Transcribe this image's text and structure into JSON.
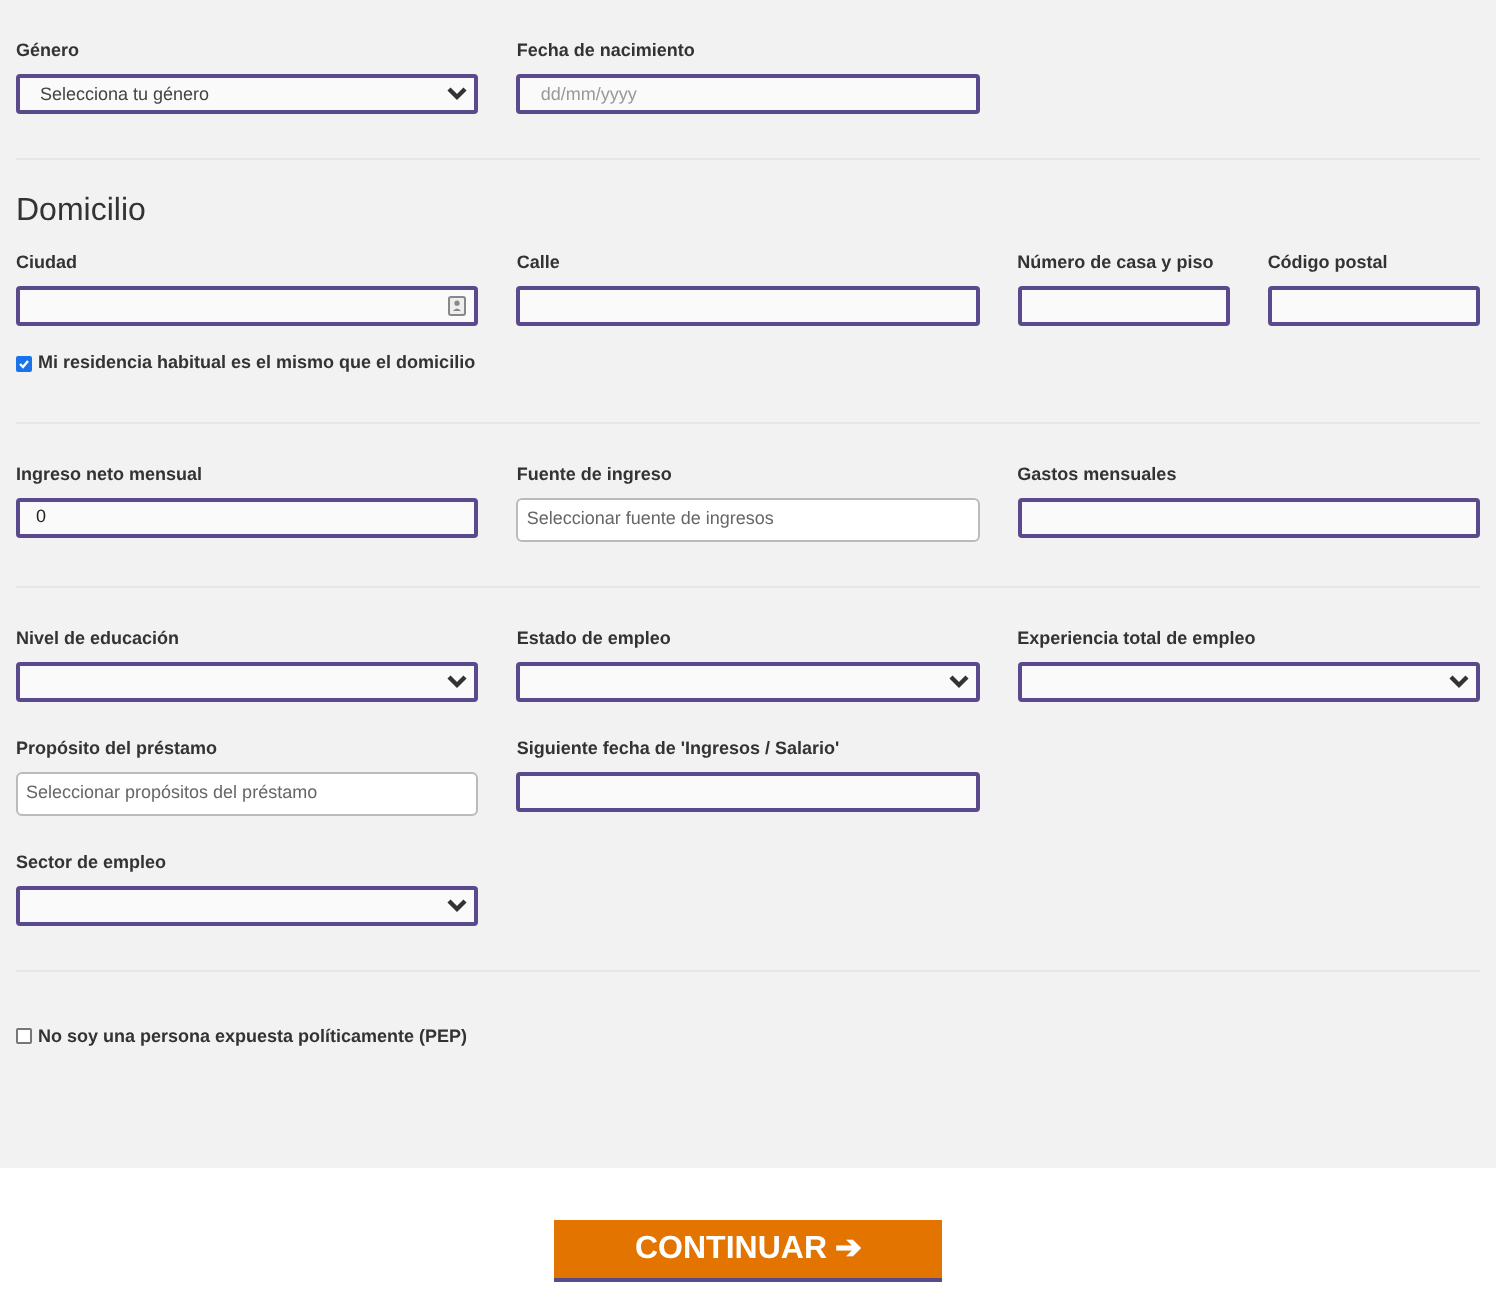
{
  "sections": [
    {
      "rows": [
        [
          {
            "kind": "select",
            "label": "Género",
            "placeholder": "Selecciona tu género"
          },
          {
            "kind": "date",
            "label": "Fecha de nacimiento",
            "placeholder": "dd/mm/yyyy"
          }
        ]
      ]
    },
    {
      "heading": "Domicilio",
      "rows": [
        [
          {
            "kind": "contact",
            "label": "Ciudad"
          },
          {
            "kind": "text",
            "label": "Calle"
          },
          {
            "kind": "pair",
            "fields": [
              {
                "kind": "text",
                "label": "Número de casa y piso"
              },
              {
                "kind": "text",
                "label": "Código postal"
              }
            ]
          }
        ]
      ],
      "checkbox": {
        "label": "Mi residencia habitual es el mismo que el domicilio",
        "checked": true
      }
    },
    {
      "rows": [
        [
          {
            "kind": "text",
            "label": "Ingreso neto mensual",
            "value": "0"
          },
          {
            "kind": "multiselect",
            "label": "Fuente de ingreso",
            "placeholder": "Seleccionar fuente de ingresos"
          },
          {
            "kind": "text",
            "label": "Gastos mensuales"
          }
        ]
      ]
    },
    {
      "rows": [
        [
          {
            "kind": "select",
            "label": "Nivel de educación"
          },
          {
            "kind": "select",
            "label": "Estado de empleo"
          },
          {
            "kind": "select",
            "label": "Experiencia total de empleo"
          }
        ],
        [
          {
            "kind": "multiselect",
            "label": "Propósito del préstamo",
            "placeholder": "Seleccionar propósitos del préstamo"
          },
          {
            "kind": "text",
            "label": "Siguiente fecha de 'Ingresos / Salario'"
          }
        ],
        [
          {
            "kind": "select",
            "label": "Sector de empleo"
          }
        ]
      ]
    },
    {
      "checkbox": {
        "label": "No soy una persona expuesta políticamente (PEP)",
        "checked": false
      }
    }
  ],
  "submit": {
    "label": "CONTINUAR",
    "icon": "➔"
  }
}
